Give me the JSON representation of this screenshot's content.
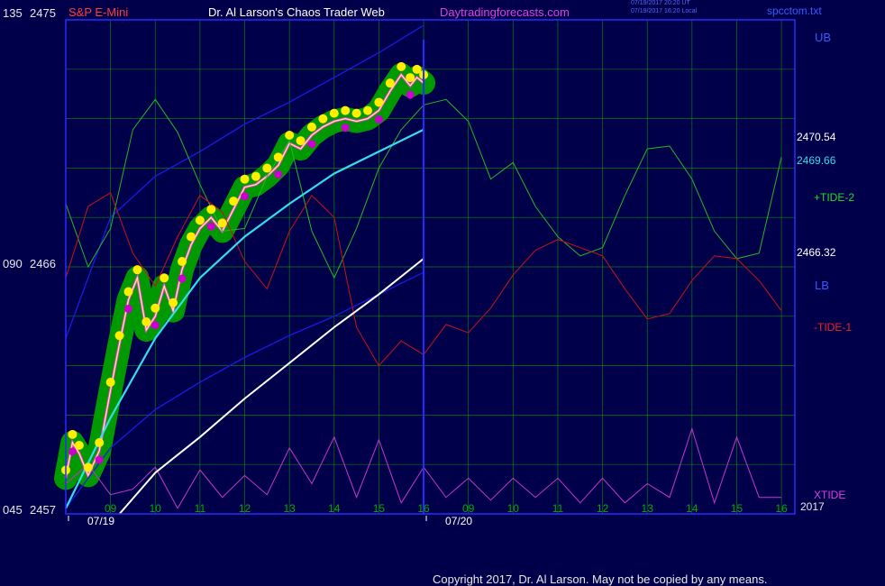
{
  "header": {
    "scale_top": "135",
    "price_top": "2475",
    "symbol": "S&P E-Mini",
    "title": "Dr. Al Larson's Chaos Trader Web",
    "site": "Daytradingforecasts.com",
    "stamp_ut": "07/19/2017 20:20 UT",
    "stamp_local": "07/19/2017 16:20 Local",
    "file": "spcctom.txt"
  },
  "left_axis": {
    "mid_scale": "090",
    "mid_price": "2466",
    "bottom_scale": "045",
    "bottom_price": "2457"
  },
  "right_labels": {
    "ub": "UB",
    "price_1": "2470.54",
    "price_2": "2469.66",
    "tide_plus": "+TIDE-2",
    "price_3": "2466.32",
    "lb": "LB",
    "tide_minus": "-TIDE-1",
    "xtide": "XTIDE",
    "year": "2017"
  },
  "footer": {
    "copyright": "Copyright 2017, Dr. Al Larson. May not be copied by any means."
  },
  "colors": {
    "background": "#00004a",
    "grid": "#00aa00",
    "frame": "#2a2aff",
    "price_band": "#009900",
    "price_line": "#ffff66",
    "price_core": "#ff33ff",
    "high_dot": "#ffee00",
    "low_dot": "#cc00cc",
    "average_cyan": "#33ddee",
    "average_white": "#ffffff",
    "band_lines": "#1a1ae6",
    "tide_plus": "#22bb22",
    "tide_minus": "#cc1111",
    "xtide": "#cc33cc"
  },
  "chart_data": {
    "type": "line",
    "title": "Dr. Al Larson's Chaos Trader Web",
    "symbol": "S&P E-Mini",
    "x_tick_labels": [
      "09",
      "10",
      "11",
      "12",
      "13",
      "14",
      "15",
      "16",
      "09",
      "10",
      "11",
      "12",
      "13",
      "14",
      "15",
      "16"
    ],
    "dates": [
      "07/19",
      "07/20"
    ],
    "x_hours": [
      9,
      10,
      11,
      12,
      13,
      14,
      15,
      16,
      17,
      18,
      19,
      20,
      21,
      22,
      23,
      24
    ],
    "ylim": [
      2457,
      2475
    ],
    "y_ticks": [
      2457,
      2466,
      2475
    ],
    "grid": true,
    "series": [
      {
        "name": "S&P E-Mini",
        "x": [
          8.0,
          8.15,
          8.3,
          8.5,
          8.75,
          9.0,
          9.2,
          9.4,
          9.6,
          9.8,
          10.0,
          10.2,
          10.4,
          10.6,
          10.8,
          11.0,
          11.25,
          11.5,
          11.75,
          12.0,
          12.25,
          12.5,
          12.75,
          13.0,
          13.25,
          13.5,
          13.75,
          14.0,
          14.25,
          14.5,
          14.75,
          15.0,
          15.25,
          15.5,
          15.7,
          15.85,
          16.0
        ],
        "y": [
          2458.3,
          2459.6,
          2459.2,
          2458.4,
          2459.3,
          2461.5,
          2463.2,
          2464.8,
          2465.6,
          2463.7,
          2464.2,
          2465.3,
          2464.4,
          2465.9,
          2466.8,
          2467.4,
          2467.8,
          2467.3,
          2468.1,
          2468.9,
          2469.0,
          2469.3,
          2469.7,
          2470.5,
          2470.3,
          2470.8,
          2471.1,
          2471.3,
          2471.4,
          2471.3,
          2471.4,
          2471.7,
          2472.4,
          2473.0,
          2472.6,
          2472.9,
          2472.7
        ]
      },
      {
        "name": "+TIDE-2",
        "x": [
          8.0,
          8.5,
          9.0,
          9.5,
          10.0,
          10.5,
          11.0,
          11.5,
          12.0,
          12.5,
          13.0,
          13.5,
          14.0,
          14.5,
          15.0,
          15.5,
          16.0,
          16.5,
          17.0,
          17.5,
          18.0,
          18.5,
          19.0,
          19.5,
          20.0,
          20.5,
          21.0,
          21.5,
          22.0,
          22.5,
          23.0,
          23.5,
          24.0
        ],
        "y": [
          2468.3,
          2466.0,
          2467.4,
          2471.0,
          2472.1,
          2470.9,
          2469.0,
          2467.3,
          2467.4,
          2469.3,
          2470.6,
          2467.3,
          2465.6,
          2467.4,
          2469.6,
          2471.0,
          2471.9,
          2472.1,
          2471.3,
          2469.2,
          2469.8,
          2468.2,
          2467.1,
          2466.4,
          2466.7,
          2468.6,
          2470.3,
          2470.4,
          2469.2,
          2467.3,
          2466.3,
          2466.5,
          2470.0
        ]
      },
      {
        "name": "-TIDE-1",
        "x": [
          8.0,
          8.5,
          9.0,
          9.5,
          10.0,
          10.5,
          11.0,
          11.5,
          12.0,
          12.5,
          13.0,
          13.5,
          14.0,
          14.5,
          15.0,
          15.5,
          16.0,
          16.5,
          17.0,
          17.5,
          18.0,
          18.5,
          19.0,
          19.5,
          20.0,
          20.5,
          21.0,
          21.5,
          22.0,
          22.5,
          23.0,
          23.5,
          24.0
        ],
        "y": [
          2465.6,
          2468.2,
          2468.7,
          2466.5,
          2465.3,
          2467.1,
          2468.6,
          2468.0,
          2466.2,
          2465.2,
          2467.3,
          2468.6,
          2467.8,
          2463.8,
          2462.4,
          2463.3,
          2462.8,
          2463.9,
          2463.6,
          2464.5,
          2465.7,
          2466.6,
          2467.0,
          2466.7,
          2466.4,
          2465.2,
          2464.1,
          2464.3,
          2465.5,
          2466.4,
          2466.3,
          2465.5,
          2464.4
        ]
      },
      {
        "name": "LB",
        "x": [
          8.0,
          9.0,
          10.0,
          11.0,
          12.0,
          13.0,
          14.0,
          15.0,
          16.0
        ],
        "y": [
          2457.2,
          2459.4,
          2460.8,
          2461.8,
          2462.7,
          2463.5,
          2464.2,
          2465.0,
          2465.8
        ]
      },
      {
        "name": "UB",
        "x": [
          8.0,
          9.0,
          10.0,
          11.0,
          12.0,
          13.0,
          14.0,
          15.0,
          16.0
        ],
        "y": [
          2463.4,
          2467.8,
          2469.3,
          2470.2,
          2471.2,
          2472.0,
          2472.9,
          2473.8,
          2474.8
        ]
      },
      {
        "name": "Average",
        "x": [
          8.0,
          9.0,
          10.0,
          11.0,
          12.0,
          13.0,
          14.0,
          15.0,
          16.0
        ],
        "y": [
          2457.2,
          2460.5,
          2463.4,
          2465.6,
          2467.1,
          2468.3,
          2469.4,
          2470.2,
          2471.0
        ]
      },
      {
        "name": "Long Average",
        "x": [
          9.2,
          10.0,
          11.0,
          12.0,
          13.0,
          14.0,
          15.0,
          16.0
        ],
        "y": [
          2457.0,
          2458.5,
          2459.8,
          2461.2,
          2462.5,
          2463.8,
          2465.0,
          2466.3
        ]
      },
      {
        "name": "XTIDE",
        "x": [
          8.0,
          8.5,
          9.0,
          9.5,
          10.0,
          10.5,
          11.0,
          11.5,
          12.0,
          12.5,
          13.0,
          13.5,
          14.0,
          14.5,
          15.0,
          15.5,
          16.0,
          16.5,
          17.0,
          17.5,
          18.0,
          18.5,
          19.0,
          19.5,
          20.0,
          20.5,
          21.0,
          21.5,
          22.0,
          22.5,
          23.0,
          23.5,
          24.0
        ],
        "y": [
          2458.1,
          2458.8,
          2457.7,
          2457.9,
          2458.7,
          2457.2,
          2458.6,
          2457.6,
          2458.4,
          2457.7,
          2459.4,
          2458.1,
          2459.8,
          2457.6,
          2459.7,
          2457.4,
          2458.7,
          2457.6,
          2458.3,
          2457.5,
          2458.3,
          2457.6,
          2458.3,
          2457.4,
          2458.3,
          2457.4,
          2458.1,
          2457.6,
          2460.1,
          2457.4,
          2459.8,
          2457.6,
          2457.6
        ]
      }
    ]
  }
}
